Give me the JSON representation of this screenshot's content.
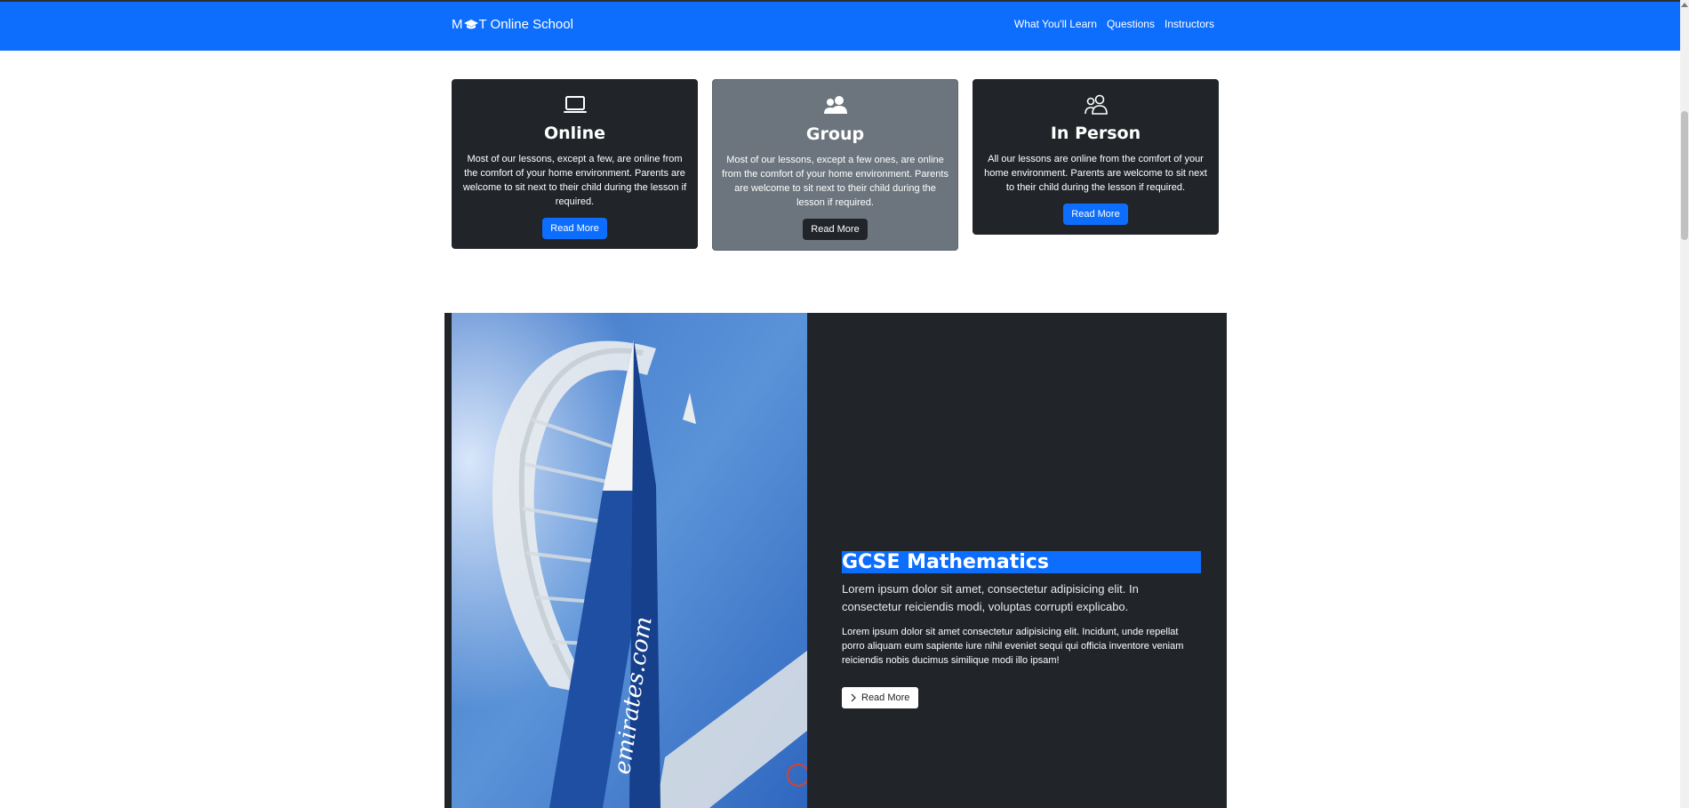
{
  "navbar": {
    "brand_prefix": "M",
    "brand_suffix": "T Online School",
    "links": [
      "What You'll Learn",
      "Questions",
      "Instructors"
    ]
  },
  "cards": [
    {
      "icon": "laptop-icon",
      "title": "Online",
      "text": "Most of our lessons, except a few, are online from the comfort of your home environment. Parents are welcome to sit next to their child during the lesson if required.",
      "button": "Read More"
    },
    {
      "icon": "people-fill-icon",
      "title": "Group",
      "text": "Most of our lessons, except a few ones, are online from the comfort of your home environment. Parents are welcome to sit next to their child during the lesson if required.",
      "button": "Read More"
    },
    {
      "icon": "people-outline-icon",
      "title": "In Person",
      "text": "All our lessons are online from the comfort of your home environment. Parents are welcome to sit next to their child during the lesson if required.",
      "button": "Read More"
    }
  ],
  "feature": {
    "image_text": "emirates.com",
    "title": "GCSE Mathematics",
    "lead": "Lorem ipsum dolor sit amet, consectetur adipisicing elit. In consectetur reiciendis modi, voluptas corrupti explicabo.",
    "body": "Lorem ipsum dolor sit amet consectetur adipisicing elit. Incidunt, unde repellat porro aliquam eum sapiente iure nihil eveniet sequi qui officia inventore veniam reiciendis nobis ducimus similique modi illo ipsam!",
    "button": "Read More"
  },
  "colors": {
    "primary": "#0d6efd",
    "dark": "#212529",
    "secondary": "#6c757d"
  }
}
